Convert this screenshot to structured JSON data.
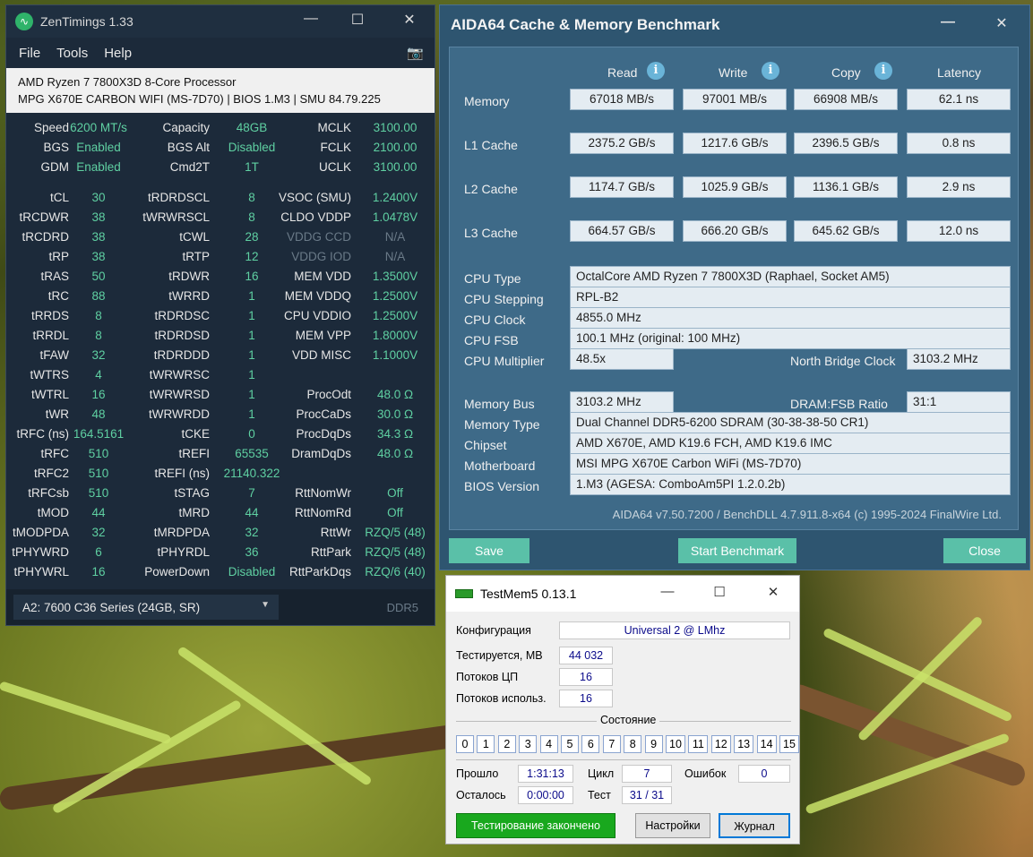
{
  "zen": {
    "title": "ZenTimings 1.33",
    "menu": [
      "File",
      "Tools",
      "Help"
    ],
    "cpu": "AMD Ryzen 7 7800X3D 8-Core Processor",
    "board": "MPG X670E CARBON WIFI (MS-7D70) | BIOS 1.M3 | SMU 84.79.225",
    "rows": [
      [
        [
          "Speed",
          "6200 MT/s"
        ],
        [
          "Capacity",
          "48GB"
        ],
        [
          "MCLK",
          "3100.00"
        ]
      ],
      [
        [
          "BGS",
          "Enabled"
        ],
        [
          "BGS Alt",
          "Disabled"
        ],
        [
          "FCLK",
          "2100.00"
        ]
      ],
      [
        [
          "GDM",
          "Enabled"
        ],
        [
          "Cmd2T",
          "1T"
        ],
        [
          "UCLK",
          "3100.00"
        ]
      ],
      [
        [
          "tCL",
          "30"
        ],
        [
          "tRDRDSCL",
          "8"
        ],
        [
          "VSOC (SMU)",
          "1.2400V"
        ]
      ],
      [
        [
          "tRCDWR",
          "38"
        ],
        [
          "tWRWRSCL",
          "8"
        ],
        [
          "CLDO VDDP",
          "1.0478V"
        ]
      ],
      [
        [
          "tRCDRD",
          "38"
        ],
        [
          "tCWL",
          "28"
        ],
        [
          "VDDG CCD",
          "N/A"
        ]
      ],
      [
        [
          "tRP",
          "38"
        ],
        [
          "tRTP",
          "12"
        ],
        [
          "VDDG IOD",
          "N/A"
        ]
      ],
      [
        [
          "tRAS",
          "50"
        ],
        [
          "tRDWR",
          "16"
        ],
        [
          "MEM VDD",
          "1.3500V"
        ]
      ],
      [
        [
          "tRC",
          "88"
        ],
        [
          "tWRRD",
          "1"
        ],
        [
          "MEM VDDQ",
          "1.2500V"
        ]
      ],
      [
        [
          "tRRDS",
          "8"
        ],
        [
          "tRDRDSC",
          "1"
        ],
        [
          "CPU VDDIO",
          "1.2500V"
        ]
      ],
      [
        [
          "tRRDL",
          "8"
        ],
        [
          "tRDRDSD",
          "1"
        ],
        [
          "MEM VPP",
          "1.8000V"
        ]
      ],
      [
        [
          "tFAW",
          "32"
        ],
        [
          "tRDRDDD",
          "1"
        ],
        [
          "VDD MISC",
          "1.1000V"
        ]
      ],
      [
        [
          "tWTRS",
          "4"
        ],
        [
          "tWRWRSC",
          "1"
        ],
        [
          "",
          ""
        ]
      ],
      [
        [
          "tWTRL",
          "16"
        ],
        [
          "tWRWRSD",
          "1"
        ],
        [
          "ProcOdt",
          "48.0 Ω"
        ]
      ],
      [
        [
          "tWR",
          "48"
        ],
        [
          "tWRWRDD",
          "1"
        ],
        [
          "ProcCaDs",
          "30.0 Ω"
        ]
      ],
      [
        [
          "tRFC (ns)",
          "164.5161"
        ],
        [
          "tCKE",
          "0"
        ],
        [
          "ProcDqDs",
          "34.3 Ω"
        ]
      ],
      [
        [
          "tRFC",
          "510"
        ],
        [
          "tREFI",
          "65535"
        ],
        [
          "DramDqDs",
          "48.0 Ω"
        ]
      ],
      [
        [
          "tRFC2",
          "510"
        ],
        [
          "tREFI (ns)",
          "21140.322"
        ],
        [
          "",
          ""
        ]
      ],
      [
        [
          "tRFCsb",
          "510"
        ],
        [
          "tSTAG",
          "7"
        ],
        [
          "RttNomWr",
          "Off"
        ]
      ],
      [
        [
          "tMOD",
          "44"
        ],
        [
          "tMRD",
          "44"
        ],
        [
          "RttNomRd",
          "Off"
        ]
      ],
      [
        [
          "tMODPDA",
          "32"
        ],
        [
          "tMRDPDA",
          "32"
        ],
        [
          "RttWr",
          "RZQ/5 (48)"
        ]
      ],
      [
        [
          "tPHYWRD",
          "6"
        ],
        [
          "tPHYRDL",
          "36"
        ],
        [
          "RttPark",
          "RZQ/5 (48)"
        ]
      ],
      [
        [
          "tPHYWRL",
          "16"
        ],
        [
          "PowerDown",
          "Disabled"
        ],
        [
          "RttParkDqs",
          "RZQ/6 (40)"
        ]
      ]
    ],
    "dimm": "A2: 7600 C36 Series (24GB, SR)",
    "ddr": "DDR5"
  },
  "aida": {
    "title": "AIDA64 Cache & Memory Benchmark",
    "headers": [
      "Read",
      "Write",
      "Copy",
      "Latency"
    ],
    "bench": [
      {
        "label": "Memory",
        "read": "67018 MB/s",
        "write": "97001 MB/s",
        "copy": "66908 MB/s",
        "latency": "62.1 ns"
      },
      {
        "label": "L1 Cache",
        "read": "2375.2 GB/s",
        "write": "1217.6 GB/s",
        "copy": "2396.5 GB/s",
        "latency": "0.8 ns"
      },
      {
        "label": "L2 Cache",
        "read": "1174.7 GB/s",
        "write": "1025.9 GB/s",
        "copy": "1136.1 GB/s",
        "latency": "2.9 ns"
      },
      {
        "label": "L3 Cache",
        "read": "664.57 GB/s",
        "write": "666.20 GB/s",
        "copy": "645.62 GB/s",
        "latency": "12.0 ns"
      }
    ],
    "cpu_type_label": "CPU Type",
    "cpu_type": "OctalCore AMD Ryzen 7 7800X3D  (Raphael, Socket AM5)",
    "cpu_stepping_label": "CPU Stepping",
    "cpu_stepping": "RPL-B2",
    "cpu_clock_label": "CPU Clock",
    "cpu_clock": "4855.0 MHz",
    "cpu_fsb_label": "CPU FSB",
    "cpu_fsb": "100.1 MHz  (original: 100 MHz)",
    "cpu_mult_label": "CPU Multiplier",
    "cpu_mult": "48.5x",
    "nb_clock_label": "North Bridge Clock",
    "nb_clock": "3103.2 MHz",
    "mem_bus_label": "Memory Bus",
    "mem_bus": "3103.2 MHz",
    "dram_ratio_label": "DRAM:FSB Ratio",
    "dram_ratio": "31:1",
    "mem_type_label": "Memory Type",
    "mem_type": "Dual Channel DDR5-6200 SDRAM  (30-38-38-50 CR1)",
    "chipset_label": "Chipset",
    "chipset": "AMD X670E, AMD K19.6 FCH, AMD K19.6 IMC",
    "mobo_label": "Motherboard",
    "mobo": "MSI MPG X670E Carbon WiFi (MS-7D70)",
    "bios_label": "BIOS Version",
    "bios": "1.M3  (AGESA: ComboAm5PI 1.2.0.2b)",
    "footer": "AIDA64 v7.50.7200 / BenchDLL 4.7.911.8-x64  (c) 1995-2024 FinalWire Ltd.",
    "save": "Save",
    "start": "Start Benchmark",
    "close": "Close"
  },
  "tm": {
    "title": "TestMem5  0.13.1",
    "config_label": "Конфигурация",
    "config": "Universal 2 @ LMhz",
    "tested_label": "Тестируется, МВ",
    "tested": "44 032",
    "threads_label": "Потоков ЦП",
    "threads": "16",
    "used_label": "Потоков использ.",
    "used": "16",
    "state_label": "Состояние",
    "cells": [
      "0",
      "1",
      "2",
      "3",
      "4",
      "5",
      "6",
      "7",
      "8",
      "9",
      "10",
      "11",
      "12",
      "13",
      "14",
      "15"
    ],
    "elapsed_label": "Прошло",
    "elapsed": "1:31:13",
    "cycle_label": "Цикл",
    "cycle": "7",
    "errors_label": "Ошибок",
    "errors": "0",
    "left_label": "Осталось",
    "left": "0:00:00",
    "test_label": "Тест",
    "test": "31 / 31",
    "status": "Тестирование закончено",
    "settings": "Настройки",
    "log": "Журнал"
  }
}
